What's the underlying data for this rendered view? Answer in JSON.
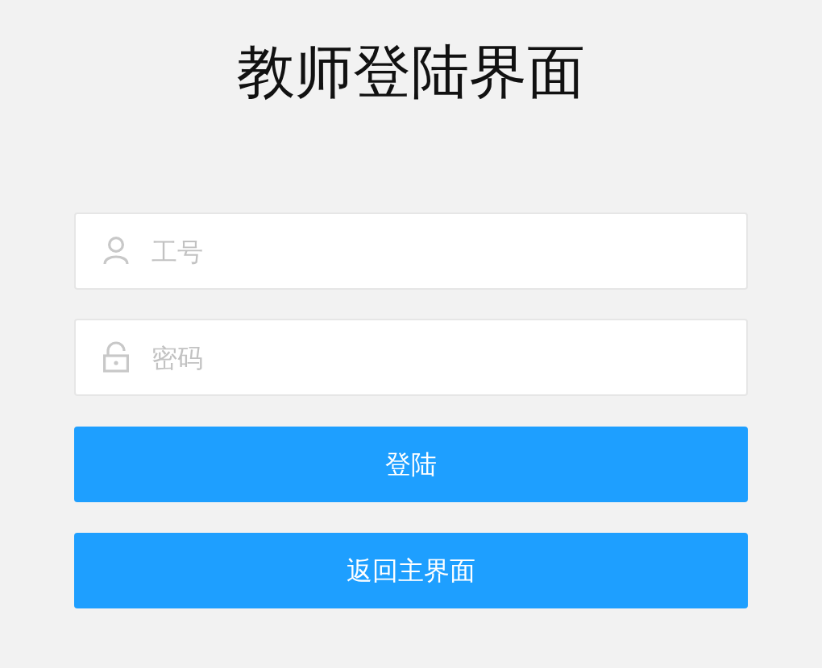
{
  "title": "教师登陆界面",
  "fields": [
    {
      "kind": "user",
      "placeholder": "工号"
    },
    {
      "kind": "lock",
      "placeholder": "密码"
    }
  ],
  "buttons": [
    "登陆",
    "返回主界面"
  ]
}
